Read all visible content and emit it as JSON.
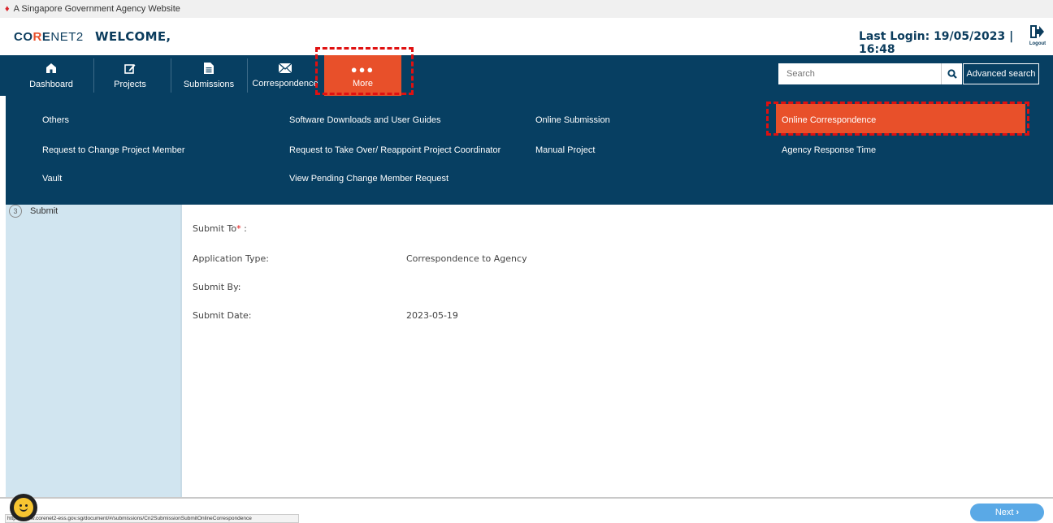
{
  "gov_banner": {
    "text": "A Singapore Government Agency Website"
  },
  "header": {
    "logo_co": "CO",
    "logo_r": "R",
    "logo_e": "E",
    "logo_net": "NET2",
    "welcome": "WELCOME,",
    "last_login": "Last Login: 19/05/2023 | 16:48",
    "logout_label": "Logout"
  },
  "nav": {
    "items": [
      {
        "label": "Dashboard",
        "icon": "home-icon"
      },
      {
        "label": "Projects",
        "icon": "edit-icon"
      },
      {
        "label": "Submissions",
        "icon": "document-icon"
      },
      {
        "label": "Correspondence",
        "icon": "envelope-icon"
      },
      {
        "label": "More",
        "icon": "more-icon"
      }
    ],
    "search_placeholder": "Search",
    "advanced_search": "Advanced search"
  },
  "mega_menu": {
    "col1": [
      "Others",
      "Request to Change Project Member",
      "Vault"
    ],
    "col2": [
      "Software Downloads and User Guides",
      "Request to Take Over/ Reappoint Project Coordinator",
      "View Pending Change Member Request"
    ],
    "col3": [
      "Online Submission",
      "Manual Project"
    ],
    "col4": [
      "Online Correspondence",
      "Agency Response Time"
    ]
  },
  "steps": {
    "step3_num": "3",
    "step3_label": "Submit"
  },
  "form": {
    "submit_to_label": "Submit To",
    "submit_to_required": "*",
    "submit_to_colon": " :",
    "application_type_label": "Application Type:",
    "application_type_value": "Correspondence to Agency",
    "submit_by_label": "Submit By:",
    "submit_date_label": "Submit Date:",
    "submit_date_value": "2023-05-19"
  },
  "footer": {
    "next_label": "Next",
    "status_url": "https://www.corenet2-ess.gov.sg/document/#/submissions/Cn2SubmissionSubmitOnlineCorrespondence"
  },
  "colors": {
    "navy": "#073f62",
    "accent_orange": "#e8502a",
    "highlight_dash": "#e01010",
    "panel_blue": "#d1e5f0",
    "next_blue": "#5aa9e6"
  }
}
